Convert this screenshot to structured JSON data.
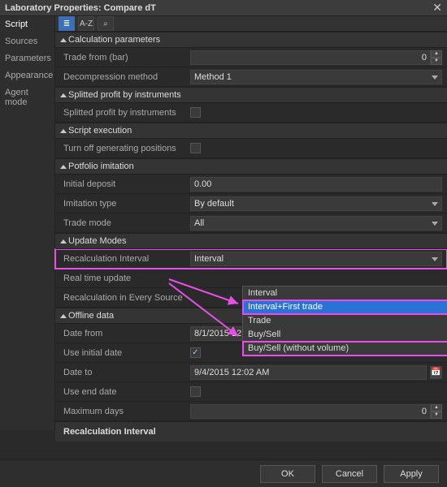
{
  "window": {
    "title": "Laboratory Properties: Compare dT"
  },
  "sidenav": {
    "items": [
      "Script",
      "Sources",
      "Parameters",
      "Appearance",
      "Agent mode"
    ],
    "activeIndex": 0
  },
  "toolbar": {
    "categorized_icon": "≣",
    "alpha_label": "A-Z",
    "search_icon": "⌕",
    "search_placeholder": ""
  },
  "groups": {
    "calc_params": {
      "title": "Calculation parameters"
    },
    "splitted_profit": {
      "title": "Splitted profit by instruments"
    },
    "script_exec": {
      "title": "Script execution"
    },
    "portfolio": {
      "title": "Potfolio imitation"
    },
    "update_modes": {
      "title": "Update Modes"
    },
    "offline": {
      "title": "Offline data"
    }
  },
  "rows": {
    "trade_from": {
      "label": "Trade from (bar)",
      "value": "0"
    },
    "decompression": {
      "label": "Decompression method",
      "value": "Method 1"
    },
    "splitted_profit_row": {
      "label": "Splitted profit by instruments",
      "checked": false
    },
    "turnoff_gen": {
      "label": "Turn off generating positions",
      "checked": false
    },
    "initial_deposit": {
      "label": "Initial deposit",
      "value": "0.00"
    },
    "imitation_type": {
      "label": "Imitation type",
      "value": "By default"
    },
    "trade_mode": {
      "label": "Trade mode",
      "value": "All"
    },
    "recalc_interval": {
      "label": "Recalculation Interval",
      "value": "Interval"
    },
    "realtime_update": {
      "label": "Real time update",
      "value": ""
    },
    "recalc_every_source": {
      "label": "Recalculation in Every Source",
      "value": ""
    },
    "date_from": {
      "label": "Date from",
      "value": "8/1/2015 12:00 AM"
    },
    "use_initial_date": {
      "label": "Use initial date",
      "checked": true,
      "checkmark": "✓"
    },
    "date_to": {
      "label": "Date to",
      "value": "9/4/2015 12:02 AM"
    },
    "use_end_date": {
      "label": "Use end date",
      "checked": false
    },
    "max_days": {
      "label": "Maximum days",
      "value": "0"
    }
  },
  "dropdown": {
    "options": [
      "Interval",
      "Interval+First trade",
      "Trade",
      "Buy/Sell",
      "Buy/Sell (without volume)"
    ],
    "selectedIndex": 1
  },
  "description": {
    "label": "Recalculation Interval"
  },
  "buttons": {
    "ok": "OK",
    "cancel": "Cancel",
    "apply": "Apply"
  },
  "icons": {
    "calendar": "📅"
  }
}
